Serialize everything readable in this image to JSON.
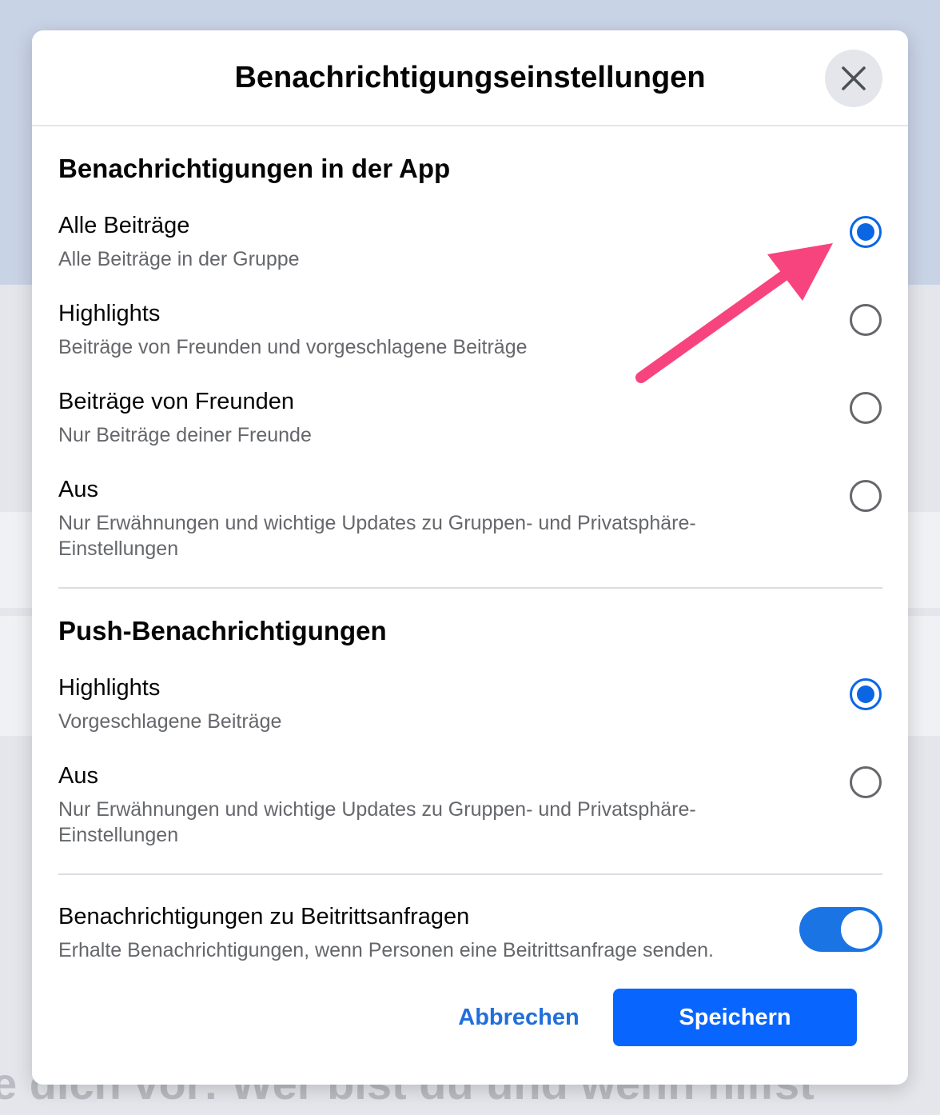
{
  "dialog": {
    "title": "Benachrichtigungseinstellungen",
    "close_icon": "close-icon"
  },
  "in_app": {
    "heading": "Benachrichtigungen in der App",
    "options": [
      {
        "title": "Alle Beiträge",
        "desc": "Alle Beiträge in der Gruppe",
        "selected": true
      },
      {
        "title": "Highlights",
        "desc": "Beiträge von Freunden und vorgeschlagene Beiträge",
        "selected": false
      },
      {
        "title": "Beiträge von Freunden",
        "desc": "Nur Beiträge deiner Freunde",
        "selected": false
      },
      {
        "title": "Aus",
        "desc": "Nur Erwähnungen und wichtige Updates zu Gruppen- und Privatsphäre-Einstellungen",
        "selected": false
      }
    ]
  },
  "push": {
    "heading": "Push-Benachrichtigungen",
    "options": [
      {
        "title": "Highlights",
        "desc": "Vorgeschlagene Beiträge",
        "selected": true
      },
      {
        "title": "Aus",
        "desc": "Nur Erwähnungen und wichtige Updates zu Gruppen- und Privatsphäre-Einstellungen",
        "selected": false
      }
    ]
  },
  "join_requests": {
    "title": "Benachrichtigungen zu Beitrittsanfragen",
    "desc": "Erhalte Benachrichtigungen, wenn Personen eine Beitrittsanfrage senden.",
    "enabled": true
  },
  "footer": {
    "cancel_label": "Abbrechen",
    "save_label": "Speichern"
  },
  "background": {
    "bottom_text": "e dich vor: Wer bist du und wenn hilfst"
  },
  "colors": {
    "accent": "#0866ff",
    "radio_selected": "#0b66e4",
    "annotation_arrow": "#f7447e"
  }
}
